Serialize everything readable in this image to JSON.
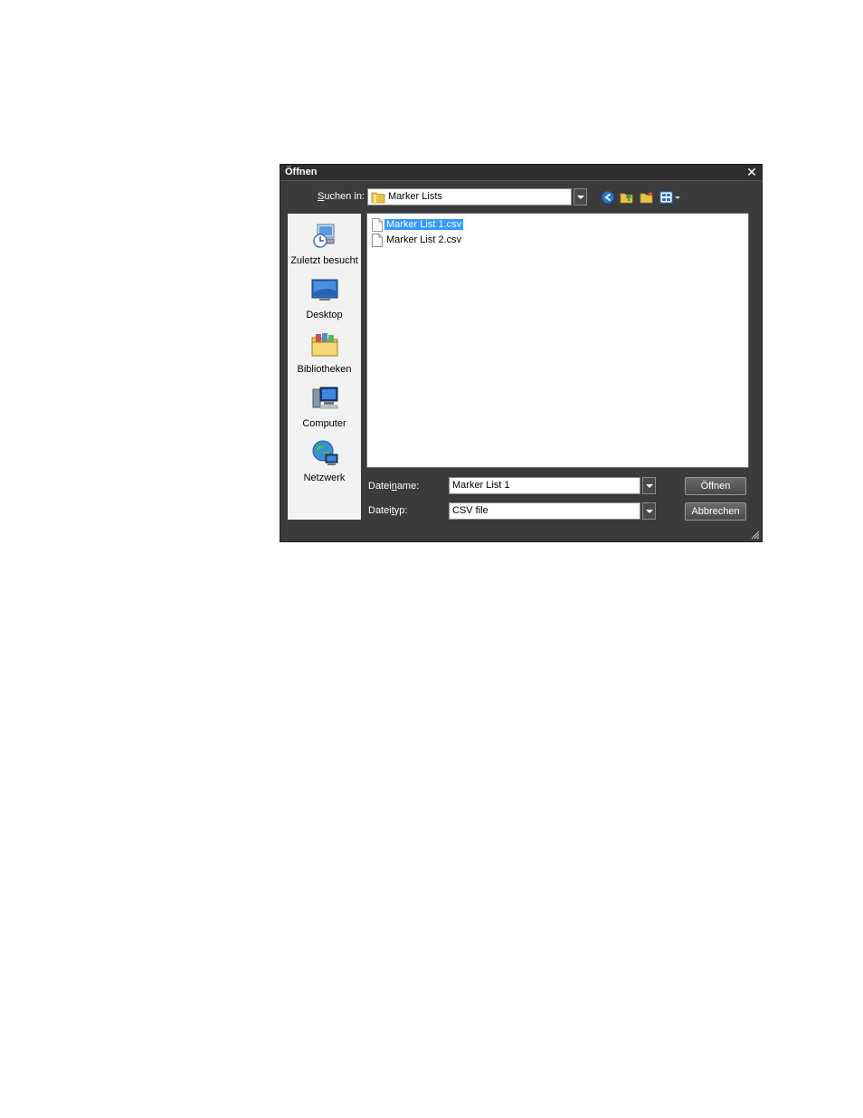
{
  "dialog": {
    "title": "Öffnen",
    "close_label": "✕"
  },
  "lookin": {
    "label_prefix": "S",
    "label_rest": "uchen in:",
    "value": "Marker Lists"
  },
  "toolbar": {
    "icons": [
      "back-icon",
      "up-folder-icon",
      "new-folder-icon",
      "view-menu-icon"
    ]
  },
  "places": [
    {
      "label": "Zuletzt besucht",
      "icon": "recent-places-icon"
    },
    {
      "label": "Desktop",
      "icon": "desktop-icon"
    },
    {
      "label": "Bibliotheken",
      "icon": "libraries-icon"
    },
    {
      "label": "Computer",
      "icon": "computer-icon"
    },
    {
      "label": "Netzwerk",
      "icon": "network-icon"
    }
  ],
  "files": [
    {
      "name": "Marker List 1.csv",
      "selected": true
    },
    {
      "name": "Marker List 2.csv",
      "selected": false
    }
  ],
  "filename": {
    "label_a": "Datei",
    "label_u": "n",
    "label_b": "ame:",
    "value": "Marker List 1"
  },
  "filetype": {
    "label_a": "Datei",
    "label_u": "t",
    "label_b": "yp:",
    "value": "CSV file"
  },
  "buttons": {
    "open_label": "Öffnen",
    "cancel_label": "Abbrechen"
  },
  "colors": {
    "dialog_bg": "#3b3b3b",
    "selection": "#3399ff"
  }
}
